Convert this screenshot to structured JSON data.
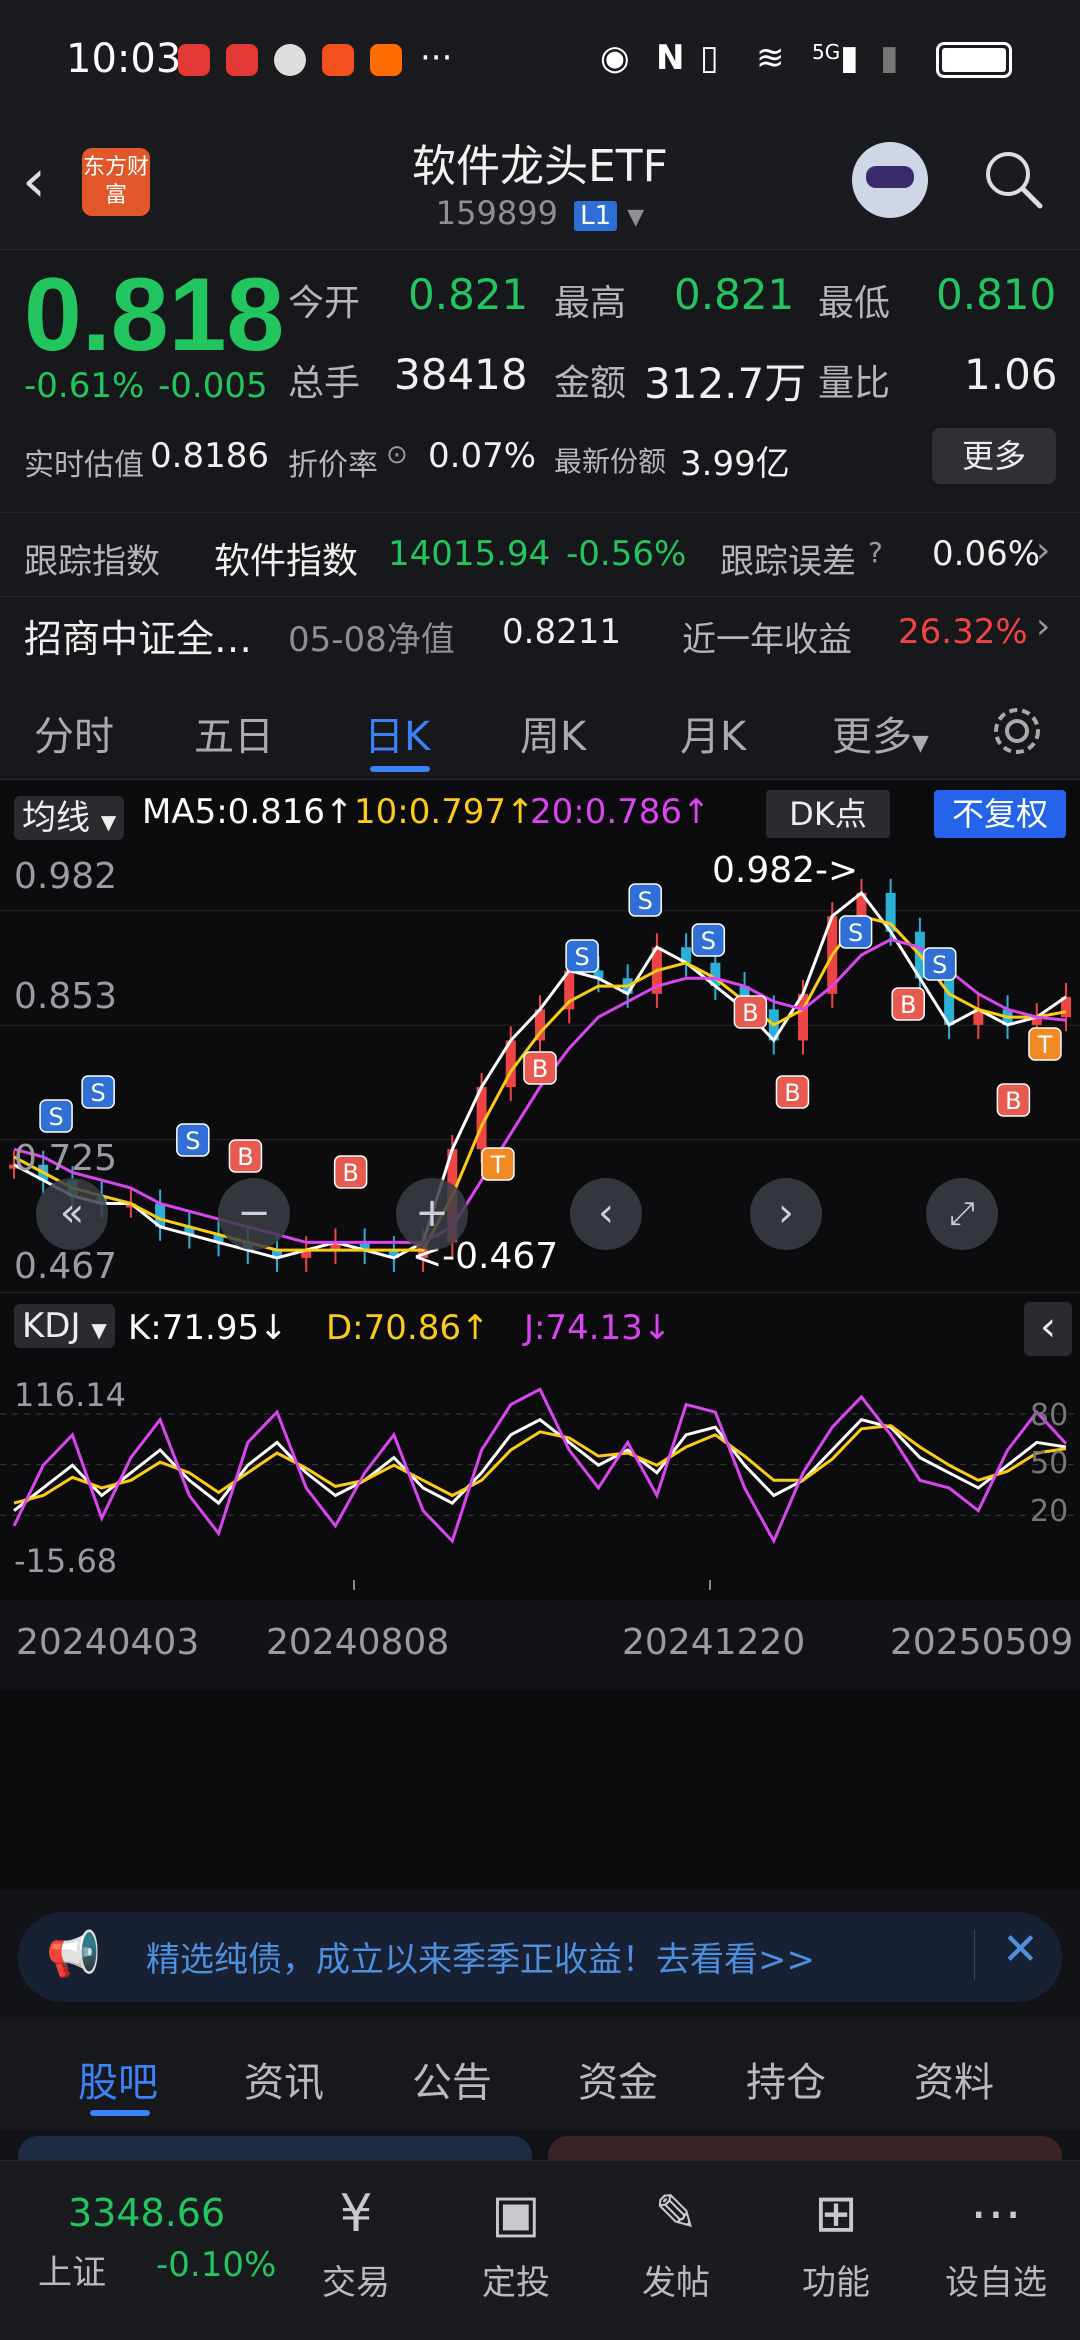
{
  "status_bar": {
    "time": "10:03",
    "more": "···",
    "network": "5G"
  },
  "header": {
    "title": "软件龙头ETF",
    "code": "159899",
    "market_badge": "L1",
    "logo_text": "东方财富"
  },
  "quote": {
    "price": "0.818",
    "change_pct": "-0.61%",
    "change_amt": "-0.005",
    "open_label": "今开",
    "open": "0.821",
    "high_label": "最高",
    "high": "0.821",
    "low_label": "最低",
    "low": "0.810",
    "volume_label": "总手",
    "volume": "38418",
    "amount_label": "金额",
    "amount": "312.7万",
    "ratio_label": "量比",
    "ratio": "1.06",
    "iopv_label": "实时估值",
    "iopv": "0.8186",
    "discount_label": "折价率",
    "discount": "0.07%",
    "shares_label": "最新份额",
    "shares": "3.99亿",
    "more_label": "更多"
  },
  "tracking": {
    "label": "跟踪指数",
    "index_name": "软件指数",
    "index_value": "14015.94",
    "index_change": "-0.56%",
    "error_label": "跟踪误差",
    "error": "0.06%"
  },
  "fund_row": {
    "name": "招商中证全…",
    "nav_label": "05-08净值",
    "nav": "0.8211",
    "return_label": "近一年收益",
    "return": "26.32%"
  },
  "kline_tabs": [
    "分时",
    "五日",
    "日K",
    "周K",
    "月K",
    "更多"
  ],
  "chart_header": {
    "ma_select": "均线",
    "ma5": "MA5:0.816↑",
    "ma10": "10:0.797↑",
    "ma20": "20:0.786↑",
    "dk": "DK点",
    "restore": "不复权"
  },
  "kdj_header": {
    "select": "KDJ",
    "k": "K:71.95↓",
    "d": "D:70.86↑",
    "j": "J:74.13↓"
  },
  "chart_data": [
    {
      "type": "line",
      "title": "",
      "y_ticks": [
        "0.982",
        "0.853",
        "0.725",
        "0.467"
      ],
      "ylim": [
        0.467,
        0.982
      ],
      "annotations": [
        "0.982->",
        "<-0.467"
      ],
      "series": [
        {
          "name": "MA5",
          "values": [
            0.6,
            0.58,
            0.56,
            0.55,
            0.55,
            0.52,
            0.51,
            0.5,
            0.49,
            0.48,
            0.49,
            0.5,
            0.49,
            0.48,
            0.5,
            0.62,
            0.7,
            0.76,
            0.8,
            0.85,
            0.84,
            0.82,
            0.88,
            0.86,
            0.83,
            0.8,
            0.76,
            0.82,
            0.92,
            0.95,
            0.9,
            0.84,
            0.78,
            0.8,
            0.78,
            0.79,
            0.816
          ]
        },
        {
          "name": "10",
          "values": [
            0.61,
            0.59,
            0.57,
            0.56,
            0.55,
            0.53,
            0.52,
            0.51,
            0.5,
            0.49,
            0.49,
            0.49,
            0.49,
            0.49,
            0.49,
            0.56,
            0.65,
            0.72,
            0.77,
            0.81,
            0.83,
            0.83,
            0.85,
            0.86,
            0.84,
            0.81,
            0.78,
            0.8,
            0.87,
            0.92,
            0.91,
            0.87,
            0.82,
            0.8,
            0.79,
            0.79,
            0.797
          ]
        },
        {
          "name": "20",
          "values": [
            0.62,
            0.61,
            0.59,
            0.58,
            0.57,
            0.55,
            0.54,
            0.53,
            0.52,
            0.51,
            0.5,
            0.5,
            0.5,
            0.5,
            0.5,
            0.52,
            0.58,
            0.64,
            0.7,
            0.75,
            0.79,
            0.81,
            0.83,
            0.84,
            0.84,
            0.83,
            0.81,
            0.8,
            0.83,
            0.87,
            0.89,
            0.88,
            0.85,
            0.82,
            0.8,
            0.79,
            0.786
          ]
        }
      ],
      "markers": [
        "S",
        "B",
        "T"
      ]
    },
    {
      "type": "line",
      "title": "",
      "y_ticks": [
        "116.14",
        "-15.68"
      ],
      "right_ticks": [
        "80",
        "50",
        "20"
      ],
      "ylim": [
        -15.68,
        116.14
      ],
      "x_ticks": [
        "20240403",
        "20240808",
        "20241220",
        "20250509"
      ],
      "series": [
        {
          "name": "K",
          "values": [
            30,
            45,
            60,
            40,
            55,
            70,
            50,
            35,
            60,
            75,
            55,
            40,
            50,
            65,
            45,
            35,
            55,
            80,
            90,
            75,
            60,
            70,
            55,
            80,
            85,
            60,
            40,
            50,
            70,
            90,
            85,
            65,
            55,
            45,
            60,
            75,
            71.95
          ]
        },
        {
          "name": "D",
          "values": [
            35,
            40,
            52,
            45,
            50,
            62,
            55,
            42,
            55,
            68,
            58,
            46,
            50,
            60,
            50,
            40,
            50,
            70,
            82,
            78,
            66,
            68,
            60,
            72,
            80,
            66,
            50,
            50,
            64,
            84,
            86,
            72,
            60,
            50,
            56,
            68,
            70.86
          ]
        },
        {
          "name": "J",
          "values": [
            20,
            60,
            80,
            25,
            65,
            90,
            40,
            15,
            75,
            95,
            45,
            20,
            55,
            80,
            30,
            10,
            70,
            100,
            110,
            70,
            45,
            75,
            40,
            100,
            95,
            45,
            10,
            55,
            85,
            105,
            80,
            50,
            45,
            30,
            70,
            95,
            74.13
          ]
        }
      ]
    }
  ],
  "chart_controls": {
    "prev": "‹",
    "next": "›"
  },
  "banner": {
    "text": "精选纯债，成立以来季季正收益！去看看>>"
  },
  "section_tabs": [
    "股吧",
    "资讯",
    "公告",
    "资金",
    "持仓",
    "资料"
  ],
  "bottom_nav": {
    "index_value": "3348.66",
    "index_name": "上证",
    "index_change": "-0.10%",
    "items": [
      {
        "label": "交易",
        "icon": "yen-icon"
      },
      {
        "label": "定投",
        "icon": "chart-icon"
      },
      {
        "label": "发帖",
        "icon": "edit-icon"
      },
      {
        "label": "功能",
        "icon": "grid-icon"
      },
      {
        "label": "设自选",
        "icon": "more-icon"
      }
    ]
  },
  "colors": {
    "up": "#ef4444",
    "down": "#22c55e",
    "accent": "#3b82f6",
    "ma5": "#ffffff",
    "ma10": "#facc15",
    "ma20": "#d946ef"
  }
}
